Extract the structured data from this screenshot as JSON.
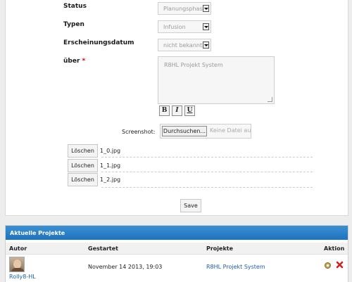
{
  "form": {
    "status_label": "Status",
    "status_value": "Planungsphase",
    "types_label": "Typen",
    "types_value": "Infusion",
    "date_label": "Erscheinungsdatum",
    "date_value": "nicht bekannt!",
    "about_label": "über",
    "about_required": "*",
    "about_text": "R8HL Projekt System",
    "format_buttons": [
      "B",
      "I",
      "U"
    ],
    "screenshot_label": "Screenshot:",
    "browse_label": "Durchsuchen...",
    "no_file_text": "Keine Datei ausgewählt.",
    "files": [
      {
        "delete_label": "Löschen",
        "name": "1_0.jpg"
      },
      {
        "delete_label": "Löschen",
        "name": "1_1.jpg"
      },
      {
        "delete_label": "Löschen",
        "name": "1_2.jpg"
      }
    ],
    "save_label": "Save"
  },
  "projects": {
    "title": "Aktuelle Projekte",
    "columns": [
      "Autor",
      "Gestartet",
      "Projekte",
      "Aktion"
    ],
    "rows": [
      {
        "author": "Rolly8-HL",
        "started": "November 14 2013, 19:03",
        "project": "R8HL Projekt System"
      }
    ]
  },
  "colors": {
    "accent": "#2a80c8",
    "required": "#cc0000",
    "link": "#1b5fa8"
  }
}
